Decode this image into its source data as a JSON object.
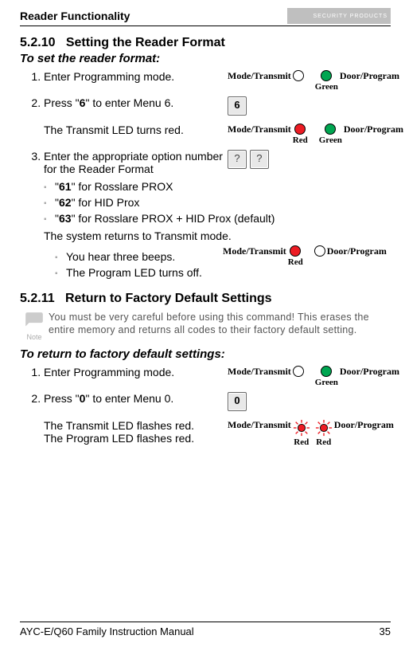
{
  "header": {
    "title": "Reader Functionality",
    "logo_text": "SECURITY PRODUCTS"
  },
  "s1": {
    "num": "5.2.10",
    "title": "Setting the Reader Format",
    "sub": "To set the reader format:",
    "step1": "Enter Programming mode.",
    "step2_a": "Press \"",
    "step2_b": "6",
    "step2_c": "\" to enter Menu 6.",
    "step2_note": "The Transmit LED turns red.",
    "step3": "Enter the appropriate option number for the Reader Format",
    "b1_a": "\"",
    "b1_b": "61",
    "b1_c": "\" for Rosslare PROX",
    "b2_a": "\"",
    "b2_b": "62",
    "b2_c": "\" for HID Prox",
    "b3_a": "\"",
    "b3_b": "63",
    "b3_c": "\" for Rosslare PROX + HID Prox (default)",
    "ret": "The system returns to Transmit mode.",
    "b4": "You hear three beeps.",
    "b5": "The Program LED turns off."
  },
  "s2": {
    "num": "5.2.11",
    "title": "Return to Factory Default Settings",
    "note_label": "Note",
    "note": "You must be very careful before using this command! This erases the entire memory and returns all codes to their factory default setting.",
    "sub": "To return to factory default settings:",
    "step1": "Enter Programming mode.",
    "step2_a": "Press \"",
    "step2_b": "0",
    "step2_c": "\" to enter Menu 0.",
    "line_a": "The Transmit LED flashes red.",
    "line_b": "The Program LED flashes red."
  },
  "led": {
    "mt": "Mode/Transmit",
    "dp": "Door/Program",
    "green": "Green",
    "red": "Red"
  },
  "keys": {
    "six": "6",
    "zero": "0",
    "q": "?"
  },
  "footer": {
    "left": "AYC-E/Q60 Family Instruction Manual",
    "right": "35"
  }
}
